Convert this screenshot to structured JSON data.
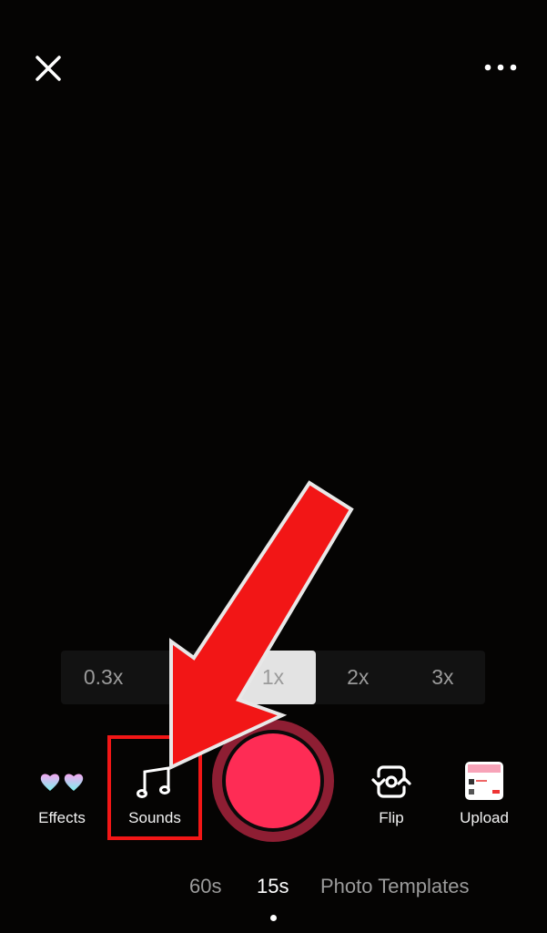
{
  "top_bar": {
    "close_icon": "close-icon",
    "more_icon": "more-horizontal-icon"
  },
  "speed": {
    "options": [
      "0.3x",
      "0.5x",
      "1x",
      "2x",
      "3x"
    ],
    "selected": "1x"
  },
  "tools": {
    "effects": {
      "label": "Effects",
      "icon": "hearts-glasses-icon"
    },
    "sounds": {
      "label": "Sounds",
      "icon": "music-note-icon"
    },
    "flip": {
      "label": "Flip",
      "icon": "flip-camera-icon"
    },
    "upload": {
      "label": "Upload",
      "icon": "gallery-thumbnail"
    }
  },
  "record_button": {
    "color": "#fe2c55",
    "ring_color": "#8e1e33"
  },
  "modes": {
    "items": [
      "60s",
      "15s",
      "Photo Templates"
    ],
    "selected": "15s"
  },
  "annotation": {
    "arrow_color": "#f21616",
    "highlight": "sounds"
  }
}
